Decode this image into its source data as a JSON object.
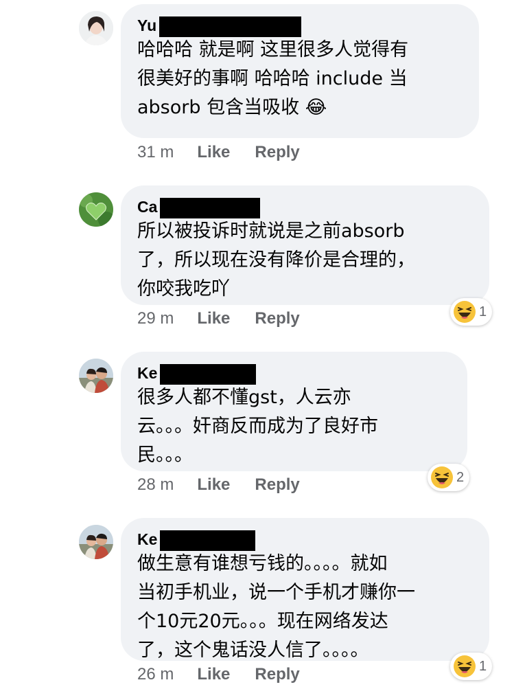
{
  "comments": [
    {
      "name": "Yu",
      "text": "哈哈哈 就是啊 这里很多人觉得有\n很美好的事啊 哈哈哈 include 当\nabsorb 包含当吸收",
      "emoji": "😂",
      "time": "31 m",
      "like": "Like",
      "reply": "Reply",
      "reaction_count": ""
    },
    {
      "name": "Ca",
      "text": "所以被投诉时就说是之前absorb\n了，所以现在没有降价是合理的，\n你咬我吃吖",
      "time": "29 m",
      "like": "Like",
      "reply": "Reply",
      "reaction_count": "1"
    },
    {
      "name": "Ke",
      "text": "很多人都不懂gst，人云亦\n云。。。奸商反而成为了良好市\n民。。。",
      "time": "28 m",
      "like": "Like",
      "reply": "Reply",
      "reaction_count": "2"
    },
    {
      "name": "Ke",
      "text": "做生意有谁想亏钱的。。。。就如\n当初手机业，说一个手机才赚你一\n个10元20元。。。现在网络发达\n了，这个鬼话没人信了。。。。",
      "time": "26 m",
      "like": "Like",
      "reply": "Reply",
      "reaction_count": "1"
    }
  ],
  "colors": {
    "bubble": "#f0f2f5",
    "meta_text": "#65676b",
    "body_text": "#050505",
    "redaction": "#000000",
    "haha_yellow": "#f7c33a"
  },
  "icons": {
    "reaction": "haha-icon"
  }
}
